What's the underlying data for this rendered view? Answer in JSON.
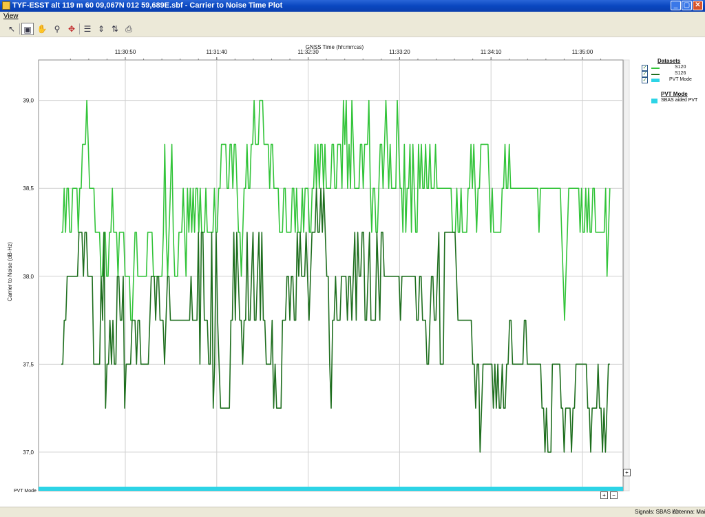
{
  "window": {
    "title": "TYF-ESST alt 119 m 60 09,067N 012 59,689E.sbf - Carrier to Noise Time Plot",
    "min_glyph": "_",
    "max_glyph": "▢",
    "close_glyph": "✕"
  },
  "menu": {
    "view_label": "View"
  },
  "toolbar": {
    "icons": [
      "pointer-icon",
      "select-icon",
      "hand-icon",
      "zoom-icon",
      "fit-icon",
      "horizontal-zoom-icon",
      "vertical-zoom-icon",
      "axis-icon",
      "print-icon"
    ],
    "glyphs": [
      "↖",
      "▣",
      "✋",
      "⚲",
      "✥",
      "☰",
      "⇕",
      "⇅",
      "⎙"
    ]
  },
  "chart_data": {
    "type": "line",
    "title": "",
    "xlabel": "GNSS Time (hh:mm:ss)",
    "ylabel": "Carrier to Noise (dB-Hz)",
    "x_tick_labels": [
      "11:30:50",
      "11:31:40",
      "11:32:30",
      "11:33:20",
      "11:34:10",
      "11:35:00"
    ],
    "y_tick_labels": [
      "39,0",
      "38,5",
      "38,0",
      "37,5",
      "37,0"
    ],
    "y_ticks": [
      39.0,
      38.5,
      38.0,
      37.5,
      37.0
    ],
    "ylim": [
      36.78,
      39.23
    ],
    "x_start": "11:30:15",
    "x_end": "11:35:15",
    "x_unit_seconds": 1,
    "grid": true,
    "legend_placement": "right",
    "series": [
      {
        "name": "S120",
        "color": "#33c43a",
        "values": [
          38.25,
          38.25,
          38.5,
          38.25,
          38.5,
          38.5,
          38.25,
          38.25,
          38.5,
          38.5,
          38.5,
          38.5,
          38.25,
          38.5,
          38.5,
          38.75,
          38.75,
          38.75,
          39.0,
          38.75,
          38.5,
          38.5,
          38.5,
          38.5,
          38.25,
          38.25,
          38.25,
          38.25,
          38.0,
          38.0,
          38.25,
          38.25,
          38.0,
          38.0,
          38.25,
          38.25,
          38.5,
          38.25,
          38.25,
          38.25,
          38.0,
          38.25,
          38.25,
          38.25,
          38.25,
          38.0,
          38.0,
          38.0,
          38.0,
          37.75,
          37.75,
          38.0,
          38.25,
          38.25,
          38.0,
          38.0,
          38.0,
          38.0,
          38.0,
          38.0,
          38.0,
          38.25,
          38.25,
          38.25,
          38.25,
          38.0,
          38.0,
          38.0,
          38.0,
          38.0,
          38.0,
          38.0,
          38.25,
          38.75,
          38.25,
          38.0,
          38.25,
          38.5,
          38.75,
          38.25,
          38.0,
          38.0,
          38.0,
          38.25,
          38.25,
          38.25,
          38.5,
          38.25,
          38.0,
          38.5,
          38.25,
          38.5,
          38.25,
          38.5,
          38.25,
          38.5,
          38.5,
          38.25,
          38.5,
          38.25,
          38.25,
          38.25,
          38.5,
          38.25,
          38.25,
          38.25,
          38.25,
          38.25,
          38.5,
          38.25,
          38.25,
          38.5,
          38.5,
          38.75,
          38.75,
          38.75,
          38.75,
          38.5,
          38.5,
          38.75,
          38.75,
          38.5,
          38.75,
          38.75,
          38.5,
          38.25,
          38.25,
          38.0,
          38.25,
          38.5,
          38.5,
          38.75,
          38.5,
          38.5,
          38.75,
          38.75,
          39.0,
          38.75,
          38.75,
          38.75,
          39.0,
          39.0,
          39.0,
          38.75,
          38.75,
          38.75,
          38.75,
          38.5,
          38.75,
          38.75,
          38.5,
          38.5,
          38.5,
          38.5,
          38.25,
          38.25,
          38.25,
          38.5,
          38.5,
          38.25,
          38.25,
          38.25,
          38.25,
          38.5,
          38.5,
          38.25,
          38.5,
          38.25,
          38.25,
          38.25,
          38.5,
          38.25,
          38.5,
          38.5,
          38.5,
          38.25,
          38.25,
          38.5,
          38.5,
          38.75,
          38.5,
          38.75,
          38.5,
          38.75,
          38.75,
          38.5,
          38.75,
          38.5,
          38.5,
          38.5,
          38.5,
          38.75,
          38.75,
          38.5,
          38.5,
          38.75,
          38.75,
          38.75,
          38.5,
          39.0,
          38.75,
          39.0,
          38.5,
          38.75,
          38.5,
          39.0,
          38.75,
          38.5,
          38.5,
          38.5,
          38.5,
          38.75,
          38.75,
          38.5,
          38.75,
          38.75,
          38.75,
          39.0,
          38.5,
          38.25,
          38.5,
          38.5,
          38.25,
          38.25,
          38.5,
          38.75,
          38.75,
          38.5,
          38.75,
          39.0,
          38.75,
          38.5,
          38.75,
          38.5,
          38.5,
          38.5,
          38.5,
          39.0,
          38.75,
          38.5,
          38.5,
          38.25,
          38.75,
          38.25,
          38.5,
          38.5,
          38.75,
          38.25,
          38.75,
          38.5,
          38.25,
          38.25,
          38.75,
          38.5,
          38.75,
          38.5,
          38.5,
          38.75,
          38.5,
          38.5,
          38.75,
          38.5,
          38.5,
          38.5,
          38.75,
          38.5,
          38.5,
          38.5,
          38.5,
          38.5,
          38.5,
          38.5,
          38.5,
          38.5,
          38.5,
          38.5,
          38.25,
          38.25,
          38.25,
          38.5,
          38.25,
          38.25,
          38.5,
          38.25,
          38.25,
          38.25,
          38.25,
          38.5,
          38.5,
          38.75,
          38.5,
          38.75,
          38.5,
          38.25,
          38.5,
          38.5,
          38.75,
          38.75,
          38.75,
          38.75,
          38.75,
          38.75,
          38.5,
          38.25,
          38.5,
          38.25,
          38.25,
          38.25,
          38.25,
          38.25,
          38.25,
          38.5,
          38.5,
          38.75,
          38.5,
          38.5,
          38.75,
          38.5,
          38.5,
          38.5,
          38.5,
          38.5,
          38.5,
          38.5,
          38.5,
          38.5,
          38.5,
          38.5,
          38.5,
          38.5,
          38.5,
          38.5,
          38.5,
          38.5,
          38.5,
          38.5,
          38.5,
          38.25,
          38.5,
          38.5,
          38.5,
          38.5,
          38.5,
          38.5,
          38.5,
          38.5,
          38.5,
          38.5,
          38.5,
          38.5,
          38.5,
          38.5,
          38.5,
          38.25,
          38.0,
          37.75,
          38.0,
          38.25,
          38.5,
          38.5,
          38.5,
          38.5,
          38.5,
          38.5,
          38.5,
          38.5,
          38.25,
          38.5,
          38.25,
          38.25,
          38.5,
          38.25,
          38.5,
          38.25,
          38.25,
          38.5,
          38.5,
          38.25,
          38.25,
          38.25,
          38.25,
          38.25,
          38.25,
          38.25,
          38.5,
          38.0,
          38.25,
          38.5
        ]
      },
      {
        "name": "S126",
        "color": "#1e6e1e",
        "values": [
          37.5,
          37.5,
          37.75,
          37.75,
          38.0,
          38.0,
          38.0,
          38.0,
          38.0,
          38.0,
          38.0,
          38.0,
          38.25,
          38.25,
          38.25,
          38.0,
          38.25,
          38.25,
          38.0,
          38.0,
          38.0,
          38.0,
          37.5,
          37.5,
          37.5,
          37.5,
          37.5,
          38.0,
          37.75,
          38.25,
          37.25,
          37.5,
          37.5,
          37.75,
          37.5,
          37.75,
          37.5,
          37.5,
          38.0,
          38.0,
          37.75,
          37.75,
          38.0,
          37.25,
          37.5,
          37.5,
          37.5,
          37.5,
          37.75,
          37.75,
          37.75,
          37.5,
          37.75,
          37.75,
          37.5,
          37.5,
          37.5,
          37.5,
          37.5,
          37.5,
          37.75,
          38.0,
          38.0,
          38.0,
          37.75,
          38.0,
          38.0,
          37.75,
          37.75,
          37.75,
          37.5,
          37.75,
          38.0,
          38.0,
          37.75,
          37.75,
          37.75,
          37.75,
          37.75,
          37.75,
          37.75,
          37.75,
          37.75,
          37.75,
          37.75,
          37.75,
          37.75,
          37.75,
          38.0,
          37.75,
          37.75,
          37.75,
          37.75,
          38.25,
          37.5,
          38.25,
          38.25,
          37.75,
          37.75,
          37.75,
          37.5,
          37.5,
          38.25,
          37.25,
          37.5,
          38.25,
          37.75,
          37.5,
          37.25,
          37.25,
          37.25,
          37.25,
          37.25,
          37.25,
          37.25,
          37.75,
          37.75,
          38.25,
          37.75,
          38.25,
          38.0,
          37.75,
          37.75,
          37.5,
          37.75,
          37.75,
          38.25,
          37.75,
          37.75,
          38.0,
          38.25,
          37.75,
          37.75,
          38.0,
          38.25,
          37.75,
          38.25,
          37.75,
          37.75,
          37.5,
          37.5,
          37.5,
          37.5,
          37.75,
          37.25,
          37.5,
          37.25,
          37.25,
          37.25,
          37.25,
          37.75,
          37.75,
          37.75,
          38.0,
          38.0,
          37.75,
          38.0,
          38.0,
          37.75,
          37.75,
          38.25,
          38.0,
          38.25,
          38.0,
          38.0,
          38.0,
          38.25,
          38.0,
          37.75,
          38.0,
          38.25,
          38.25,
          38.25,
          38.5,
          38.25,
          38.25,
          38.5,
          38.25,
          38.5,
          38.25,
          38.0,
          38.0,
          37.5,
          37.25,
          37.75,
          37.75,
          38.0,
          37.75,
          37.75,
          37.75,
          38.0,
          38.0,
          38.0,
          38.0,
          37.75,
          38.0,
          38.0,
          37.75,
          38.0,
          38.25,
          37.75,
          38.25,
          38.0,
          38.0,
          38.25,
          38.25,
          37.75,
          37.75,
          38.0,
          38.25,
          37.75,
          37.75,
          37.75,
          37.75,
          38.25,
          38.0,
          37.75,
          38.25,
          38.25,
          38.0,
          38.0,
          38.0,
          38.0,
          38.0,
          38.0,
          38.0,
          38.0,
          38.0,
          38.0,
          38.0,
          37.75,
          38.0,
          38.0,
          38.0,
          38.0,
          38.0,
          38.0,
          38.0,
          38.0,
          38.0,
          38.0,
          37.75,
          37.75,
          38.0,
          38.0,
          37.75,
          37.75,
          37.75,
          37.5,
          37.5,
          37.75,
          38.0,
          38.0,
          37.75,
          37.75,
          38.0,
          38.25,
          37.5,
          37.5,
          37.5,
          38.25,
          38.25,
          38.25,
          38.25,
          38.25,
          38.25,
          38.25,
          38.25,
          38.0,
          37.75,
          37.75,
          37.75,
          37.75,
          37.75,
          37.75,
          37.75,
          37.75,
          37.75,
          37.75,
          37.5,
          37.5,
          37.25,
          37.5,
          37.5,
          37.0,
          37.25,
          37.5,
          37.5,
          37.5,
          37.5,
          37.5,
          37.5,
          37.5,
          37.25,
          37.5,
          37.25,
          37.5,
          37.25,
          37.25,
          37.5,
          37.25,
          37.25,
          37.5,
          37.5,
          37.75,
          37.75,
          37.5,
          37.5,
          37.5,
          37.5,
          37.5,
          37.5,
          37.5,
          37.5,
          37.75,
          37.75,
          37.5,
          37.5,
          37.5,
          37.5,
          37.5,
          37.5,
          37.5,
          37.5,
          37.5,
          37.5,
          37.25,
          37.25,
          37.0,
          37.25,
          37.0,
          37.0,
          37.0,
          37.5,
          37.5,
          37.5,
          37.5,
          37.5,
          37.5,
          37.25,
          37.25,
          37.0,
          37.25,
          37.25,
          37.25,
          37.25,
          37.0,
          37.25,
          37.25,
          37.5,
          37.5,
          37.5,
          37.5,
          37.5,
          37.5,
          37.5,
          37.5,
          37.25,
          37.25,
          37.0,
          37.25,
          37.25,
          37.25,
          37.25,
          37.5,
          37.25,
          37.25,
          37.0,
          37.25,
          37.0,
          37.25,
          37.5,
          37.5
        ]
      }
    ],
    "pvt_mode": {
      "label": "PVT Mode",
      "color": "#2dd4e6"
    }
  },
  "legend": {
    "title": "Datasets",
    "items": [
      {
        "label": "S120",
        "color": "#33c43a",
        "checked": "✓"
      },
      {
        "label": "S126",
        "color": "#1e6e1e",
        "checked": "✓"
      },
      {
        "label": "PVT Mode",
        "color": "#2dd4e6",
        "checked": "✓"
      }
    ],
    "pvt_title": "PVT Mode",
    "pvt_item": "SBAS aided PVT"
  },
  "zoom": {
    "plus": "+",
    "minus": "−"
  },
  "status": {
    "signals": "Signals: SBAS L1",
    "antenna": "Antenna: Main"
  }
}
